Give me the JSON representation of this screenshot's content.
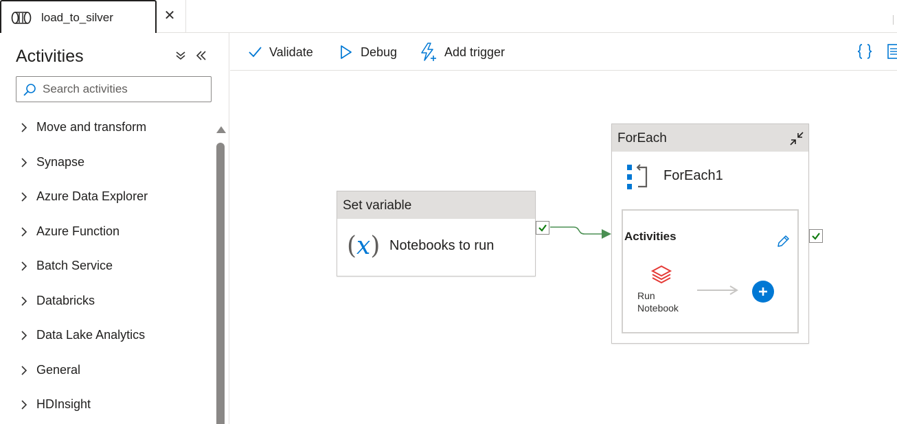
{
  "tabs": [
    {
      "label": "load_to_silver",
      "icon": "pipeline-icon",
      "active": true
    }
  ],
  "left_panel": {
    "title": "Activities",
    "search": {
      "placeholder": "Search activities",
      "value": ""
    },
    "categories": [
      {
        "label": "Move and transform"
      },
      {
        "label": "Synapse"
      },
      {
        "label": "Azure Data Explorer"
      },
      {
        "label": "Azure Function"
      },
      {
        "label": "Batch Service"
      },
      {
        "label": "Databricks"
      },
      {
        "label": "Data Lake Analytics"
      },
      {
        "label": "General"
      },
      {
        "label": "HDInsight"
      }
    ]
  },
  "toolbar": {
    "validate_label": "Validate",
    "debug_label": "Debug",
    "add_trigger_label": "Add trigger",
    "code_icon": "braces-icon",
    "properties_icon": "properties-icon"
  },
  "canvas": {
    "set_variable": {
      "type": "Set variable",
      "name": "Notebooks to run",
      "icon_text": "(𝑥)"
    },
    "foreach": {
      "type": "ForEach",
      "name": "ForEach1",
      "inner": {
        "title": "Activities",
        "activity_name": "Run Notebook",
        "activity_icon": "databricks-icon"
      }
    }
  },
  "colors": {
    "accent": "#0078d4",
    "success": "#107c10",
    "connector": "#4a8f52",
    "databricks": "#e53935",
    "header_gray": "#e1dfdd"
  }
}
